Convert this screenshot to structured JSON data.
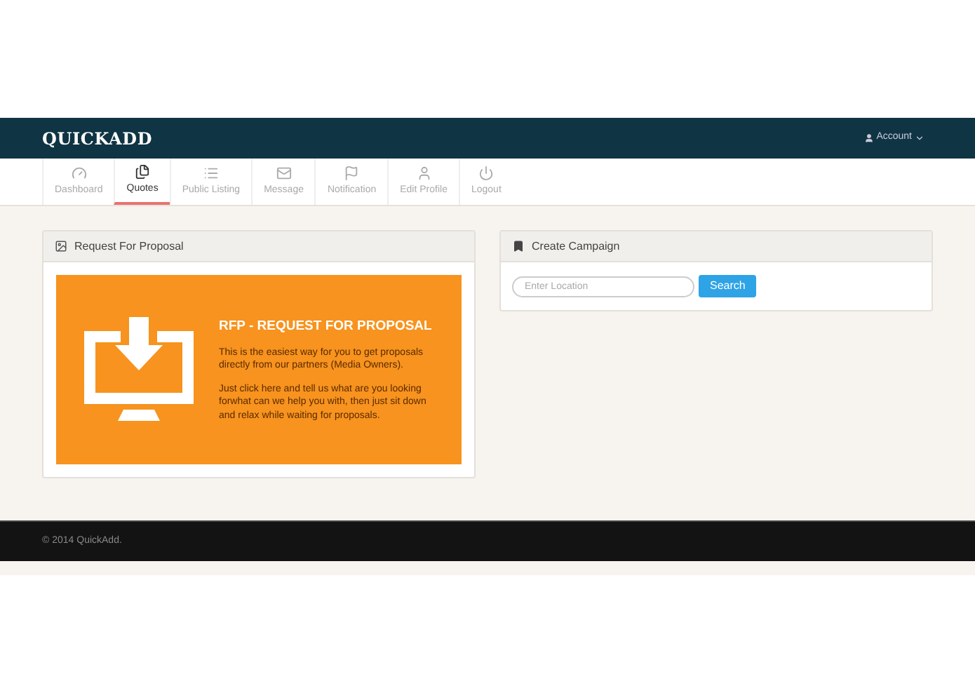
{
  "navbar": {
    "brand": "QUICKADD",
    "account": "Account"
  },
  "tabs": [
    {
      "label": "Dashboard",
      "selected": false
    },
    {
      "label": "Quotes",
      "selected": true
    },
    {
      "label": "Public Listing",
      "selected": false
    },
    {
      "label": "Message",
      "selected": false
    },
    {
      "label": "Notification",
      "selected": false
    },
    {
      "label": "Edit Profile",
      "selected": false
    },
    {
      "label": "Logout",
      "selected": false
    }
  ],
  "rfp_panel": {
    "title": "Request For Proposal",
    "banner": {
      "heading": "RFP - REQUEST FOR PROPOSAL",
      "paragraphs": [
        "This is the easiest way for you to get proposals directly from our partners (Media Owners).",
        "Just click here and tell us what are you looking forwhat can we help you with, then just sit down and relax while waiting for proposals."
      ]
    }
  },
  "campaign_panel": {
    "title": "Create Campaign",
    "location": {
      "placeholder": "Enter Location"
    },
    "search_button": "Search"
  },
  "footer": {
    "copyright": "© 2014 QuickAdd."
  }
}
